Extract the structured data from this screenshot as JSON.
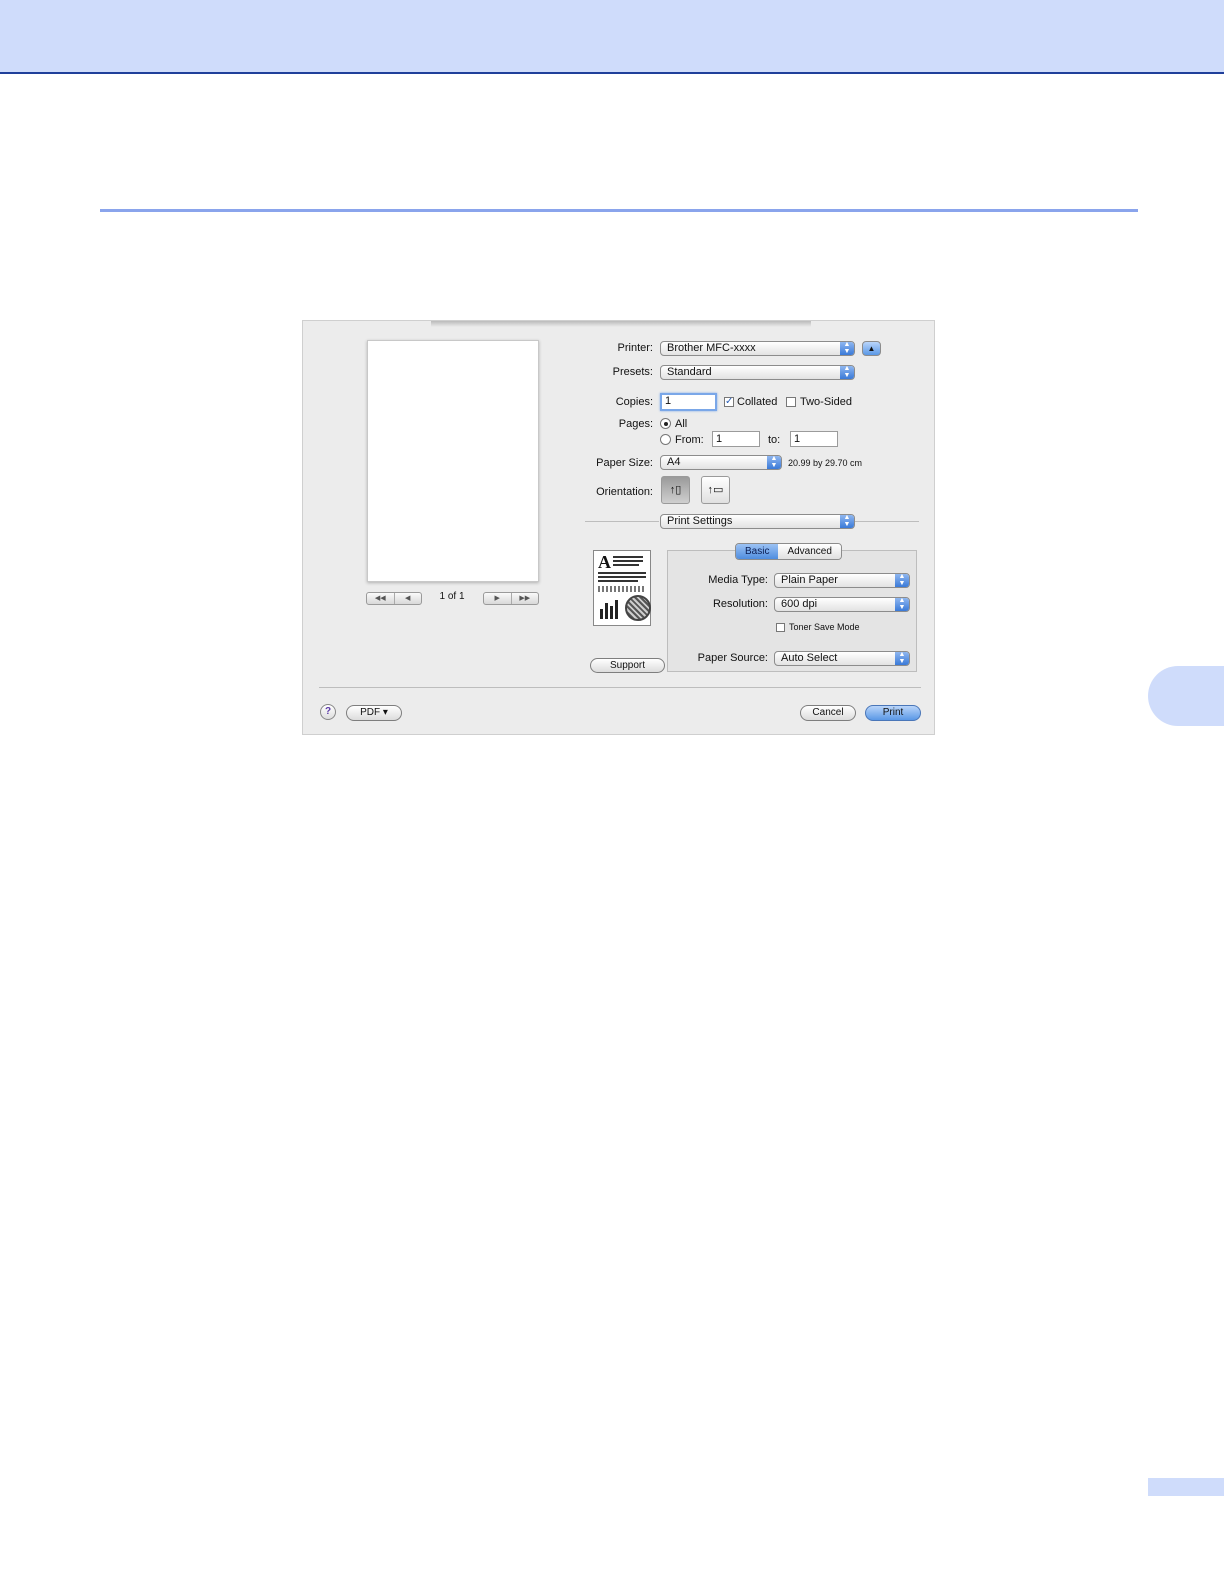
{
  "dialog": {
    "printer": {
      "label": "Printer:",
      "value": "Brother MFC-xxxx"
    },
    "presets": {
      "label": "Presets:",
      "value": "Standard"
    },
    "copies": {
      "label": "Copies:",
      "value": "1",
      "collated_label": "Collated",
      "collated": true,
      "two_sided_label": "Two-Sided",
      "two_sided": false
    },
    "pages": {
      "label": "Pages:",
      "all_label": "All",
      "from_label": "From:",
      "from_value": "1",
      "to_label": "to:",
      "to_value": "1",
      "selected": "all"
    },
    "paper_size": {
      "label": "Paper Size:",
      "value": "A4",
      "dimensions": "20.99 by 29.70 cm"
    },
    "orientation": {
      "label": "Orientation:",
      "selected": "portrait"
    },
    "panel_select": {
      "value": "Print Settings"
    },
    "preview": {
      "page_count": "1 of 1"
    },
    "tabs": [
      {
        "label": "Basic",
        "selected": true
      },
      {
        "label": "Advanced",
        "selected": false
      }
    ],
    "media_type": {
      "label": "Media Type:",
      "value": "Plain Paper"
    },
    "resolution": {
      "label": "Resolution:",
      "value": "600 dpi"
    },
    "toner_save": {
      "label": "Toner Save Mode",
      "checked": false
    },
    "paper_source": {
      "label": "Paper Source:",
      "value": "Auto Select"
    },
    "support_label": "Support",
    "help_label": "?",
    "pdf_label": "PDF ▾",
    "cancel_label": "Cancel",
    "print_label": "Print",
    "accent_color": "#4f8ddf"
  }
}
